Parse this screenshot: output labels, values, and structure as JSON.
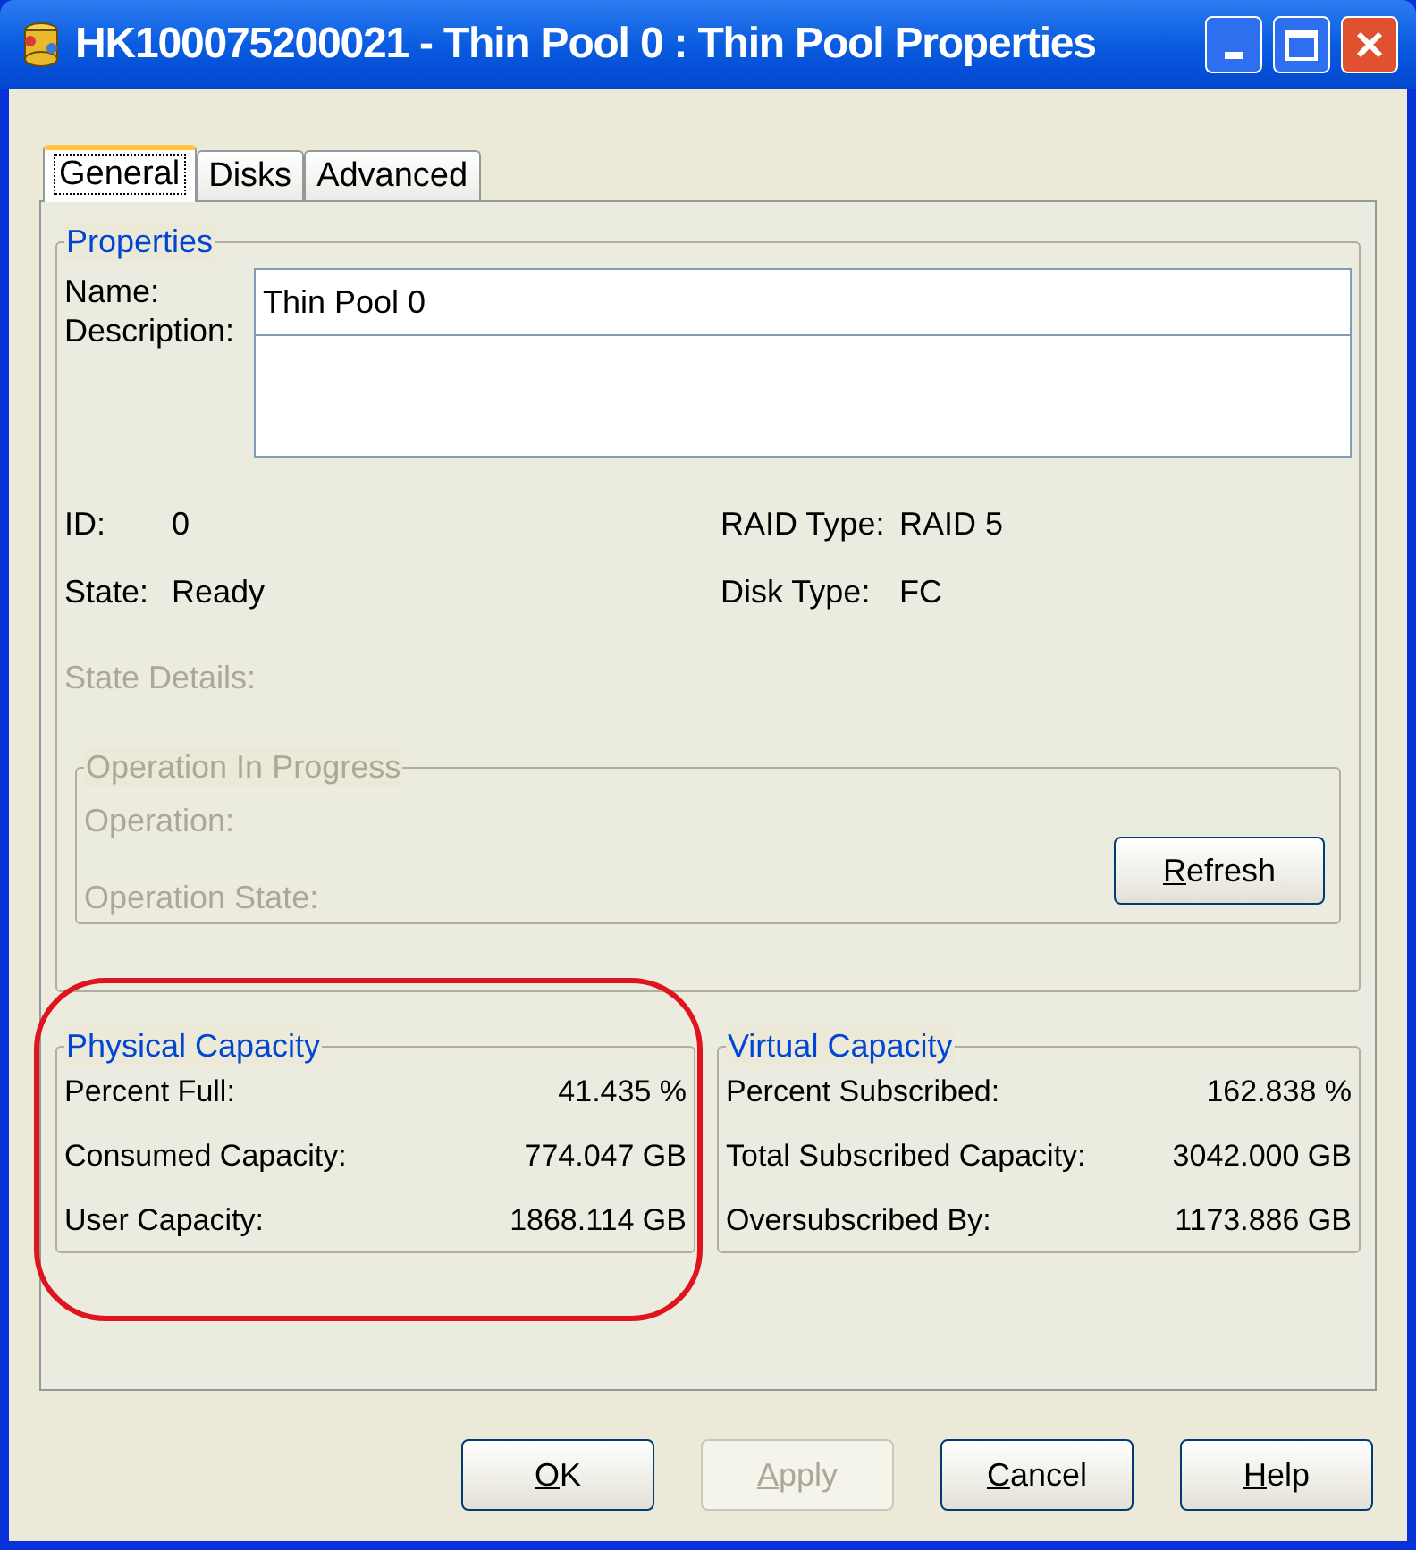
{
  "window": {
    "title": "HK100075200021 - Thin Pool 0 : Thin Pool Properties"
  },
  "tabs": [
    {
      "label": "General",
      "selected": true
    },
    {
      "label": "Disks",
      "selected": false
    },
    {
      "label": "Advanced",
      "selected": false
    }
  ],
  "properties": {
    "title": "Properties",
    "name": {
      "label": "Name:",
      "value": "Thin Pool 0"
    },
    "description": {
      "label": "Description:"
    },
    "rows": [
      [
        {
          "label": "ID:",
          "value": "0"
        },
        {
          "label": "RAID Type:",
          "value": "RAID 5"
        }
      ],
      [
        {
          "label": "State:",
          "value": "Ready"
        },
        {
          "label": "Disk Type:",
          "value": "FC"
        }
      ]
    ],
    "state_details": {
      "label": "State Details:",
      "disabled": true
    }
  },
  "operation": {
    "title": "Operation In Progress",
    "disabled": true,
    "fields": [
      {
        "label": "Operation:",
        "disabled": true
      },
      {
        "label": "Operation State:",
        "disabled": true
      }
    ],
    "refresh_button": {
      "label": "Refresh",
      "underline_first": true
    }
  },
  "capacity_groups": [
    {
      "title": "Physical Capacity",
      "highlighted": true,
      "rows": [
        {
          "label": "Percent Full:",
          "value": "41.435 %"
        },
        {
          "label": "Consumed Capacity:",
          "value": "774.047 GB"
        },
        {
          "label": "User Capacity:",
          "value": "1868.114 GB"
        }
      ]
    },
    {
      "title": "Virtual Capacity",
      "highlighted": false,
      "rows": [
        {
          "label": "Percent Subscribed:",
          "value": "162.838 %"
        },
        {
          "label": "Total Subscribed Capacity:",
          "value": "3042.000 GB"
        },
        {
          "label": "Oversubscribed By:",
          "value": "1173.886 GB"
        }
      ]
    }
  ],
  "buttons": [
    {
      "label": "OK",
      "disabled": false,
      "underline_first": true
    },
    {
      "label": "Apply",
      "disabled": true,
      "underline_first": true
    },
    {
      "label": "Cancel",
      "disabled": false,
      "underline_first": true
    },
    {
      "label": "Help",
      "disabled": false,
      "underline_first": true
    }
  ]
}
